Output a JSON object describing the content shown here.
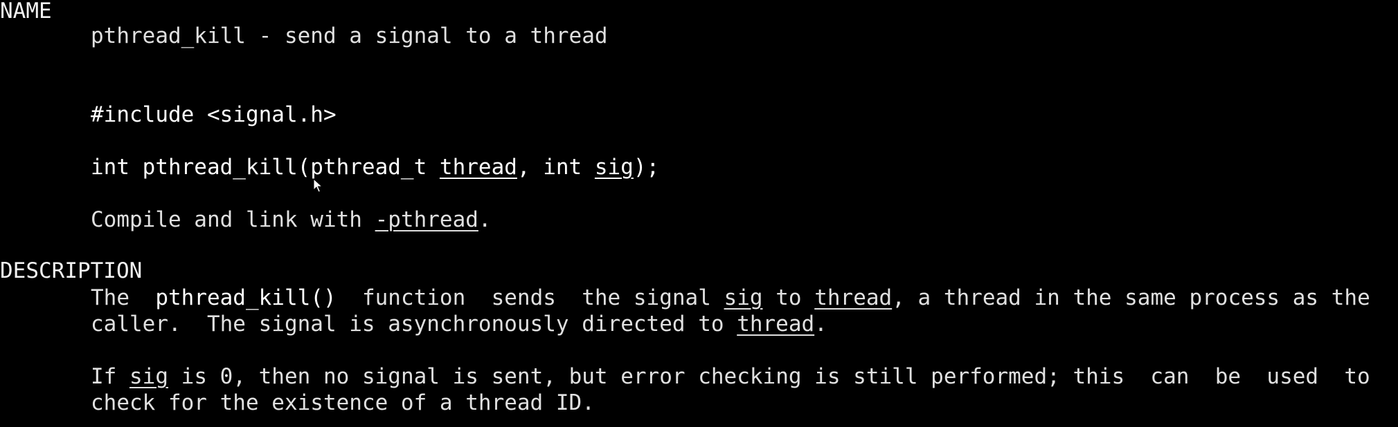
{
  "sections": {
    "name": {
      "heading": "NAME",
      "summary": "pthread_kill - send a signal to a thread"
    },
    "synopsis": {
      "include": "#include <signal.h>",
      "proto_pre": "int pthread_kill(pthread_t ",
      "proto_arg1": "thread",
      "proto_mid": ", int ",
      "proto_arg2": "sig",
      "proto_post": ");",
      "compile_pre": "Compile and link with ",
      "compile_flag": "-pthread",
      "compile_post": "."
    },
    "description": {
      "heading": "DESCRIPTION",
      "p1_l1_a": "The  ",
      "p1_l1_func": "pthread_kill()",
      "p1_l1_b": "  function  sends  the signal ",
      "p1_l1_sig": "sig",
      "p1_l1_c": " to ",
      "p1_l1_thread": "thread",
      "p1_l1_d": ", a thread in the same process as the",
      "p1_l2_a": "caller.  The signal is asynchronously directed to ",
      "p1_l2_thread": "thread",
      "p1_l2_b": ".",
      "p2_l1_a": "If ",
      "p2_l1_sig": "sig",
      "p2_l1_b": " is 0, then no signal is sent, but error checking is still performed; this  can  be  used  to",
      "p2_l2": "check for the existence of a thread ID."
    }
  },
  "colors": {
    "background": "#000000",
    "text": "#e0e0e0",
    "bold": "#ffffff"
  },
  "icons": {
    "cursor": "mouse-pointer-icon"
  }
}
